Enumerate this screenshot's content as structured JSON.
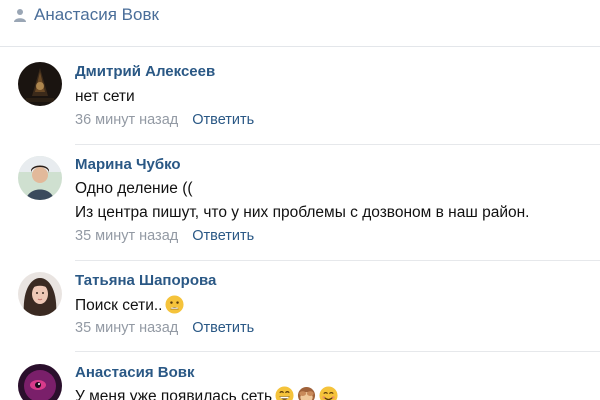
{
  "post": {
    "author": "Анастасия Вовк"
  },
  "comments": [
    {
      "author": "Дмитрий Алексеев",
      "lines": [
        "нет сети"
      ],
      "time": "36 минут назад",
      "reply": "Ответить"
    },
    {
      "author": "Марина Чубко",
      "lines": [
        "Одно деление ((",
        "Из центра пишут, что у них проблемы с дозвоном в наш район."
      ],
      "time": "35 минут назад",
      "reply": "Ответить"
    },
    {
      "author": "Татьяна Шапорова",
      "lines": [
        "Поиск сети.."
      ],
      "emoji": [
        "frowning-face-emoji"
      ],
      "time": "35 минут назад",
      "reply": "Ответить"
    },
    {
      "author": "Анастасия Вовк",
      "lines": [
        "У меня уже появилась сеть"
      ],
      "emoji": [
        "grinning-face-emoji",
        "see-no-evil-monkey-emoji",
        "smiling-face-emoji"
      ]
    }
  ],
  "colors": {
    "link": "#2a5885",
    "muted": "#939aa4",
    "text": "#111111",
    "divider": "#e6e8eb"
  }
}
